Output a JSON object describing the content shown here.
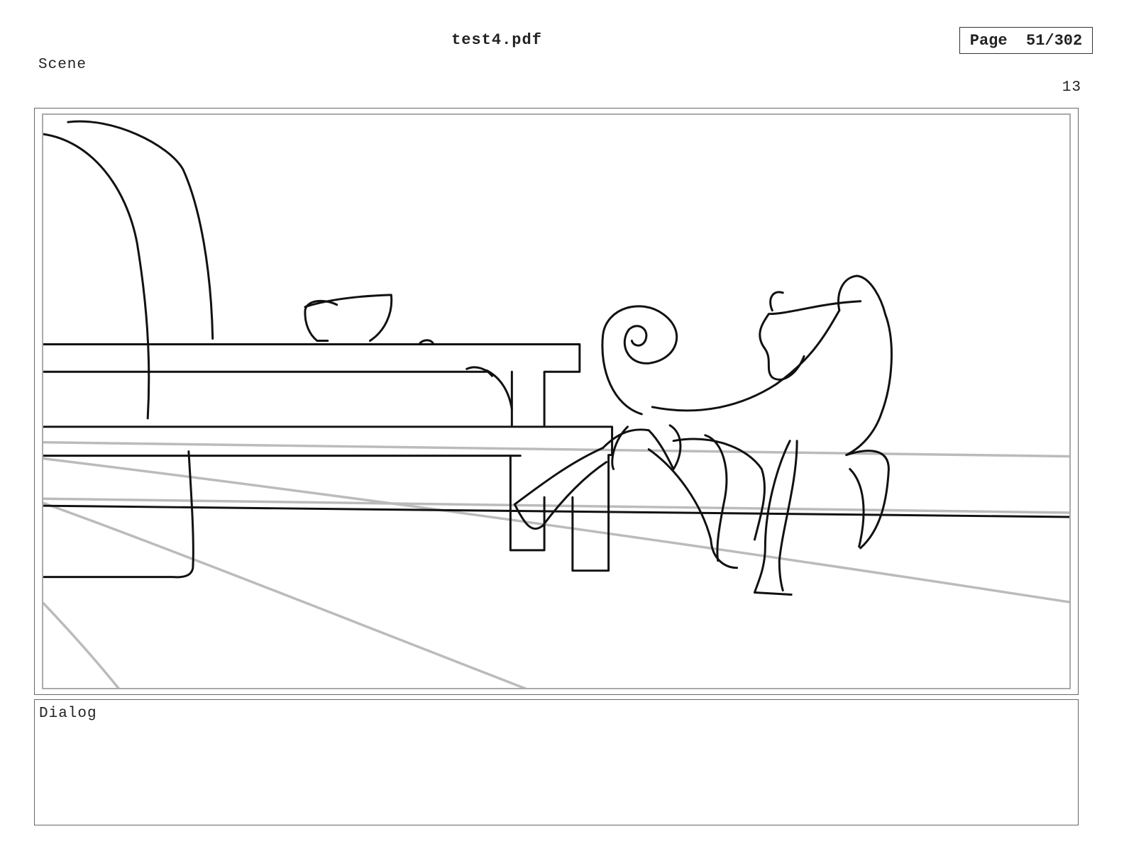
{
  "header": {
    "file_name": "test4.pdf",
    "page_indicator": "Page  51/302"
  },
  "scene": {
    "label": "Scene",
    "panel_number": "13"
  },
  "sketch": {
    "subject": "rough storyboard sketch: sofa arm, long table with bowl, dog with curled tail, perspective floor lines",
    "line_color": "#111111",
    "guide_color": "#bbbbbb"
  },
  "dialog": {
    "label": "Dialog",
    "text": ""
  }
}
